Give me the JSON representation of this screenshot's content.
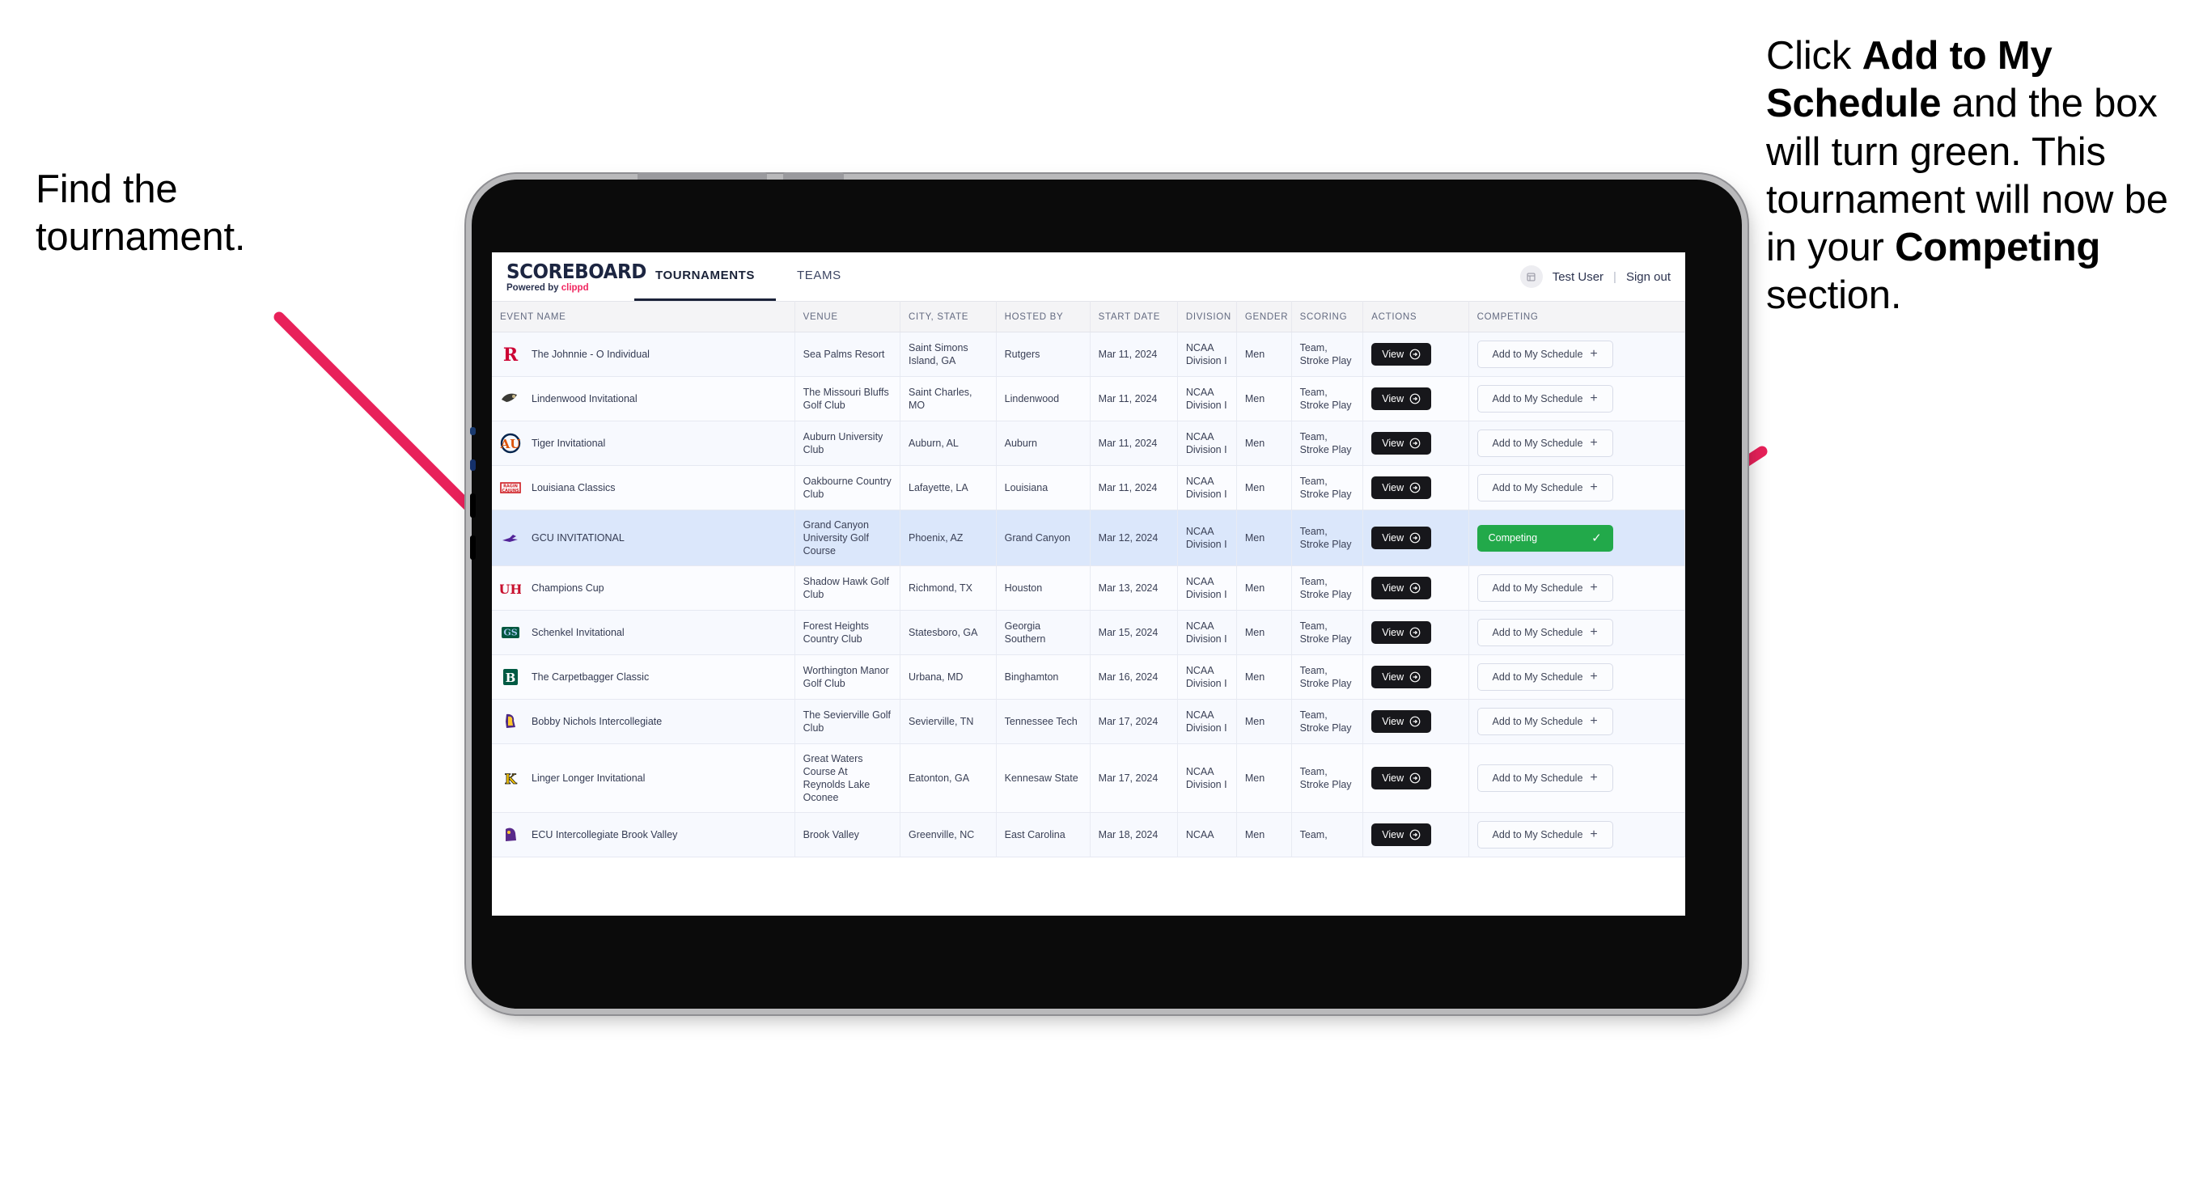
{
  "annotations": {
    "left": {
      "lines": [
        "Find the",
        "tournament."
      ]
    },
    "right": {
      "segments": [
        {
          "t": "Click ",
          "b": false
        },
        {
          "t": "Add to My Schedule",
          "b": true
        },
        {
          "t": " and the box will turn green. This tournament will now be in your ",
          "b": false
        },
        {
          "t": "Competing",
          "b": true
        },
        {
          "t": " section.",
          "b": false
        }
      ]
    },
    "arrow_color": "#E8215A"
  },
  "app": {
    "brand": {
      "title": "SCOREBOARD",
      "sub_prefix": "Powered by ",
      "sub_brand": "clippd"
    },
    "nav": [
      {
        "label": "TOURNAMENTS",
        "active": true
      },
      {
        "label": "TEAMS",
        "active": false
      }
    ],
    "header_right": {
      "avatar_icon": "user-avatar-icon",
      "user": "Test User",
      "separator": "|",
      "signout": "Sign out"
    },
    "table": {
      "columns": [
        "EVENT NAME",
        "VENUE",
        "CITY, STATE",
        "HOSTED BY",
        "START DATE",
        "DIVISION",
        "GENDER",
        "SCORING",
        "ACTIONS",
        "COMPETING"
      ],
      "view_label": "View",
      "add_label": "Add to My Schedule",
      "competing_label": "Competing",
      "rows": [
        {
          "logo": "rutgers-logo",
          "event": "The Johnnie - O Individual",
          "venue": "Sea Palms Resort",
          "city": "Saint Simons Island, GA",
          "hosted_by": "Rutgers",
          "start_date": "Mar 11, 2024",
          "division": "NCAA Division I",
          "gender": "Men",
          "scoring": "Team, Stroke Play",
          "competing": false
        },
        {
          "logo": "lindenwood-logo",
          "event": "Lindenwood Invitational",
          "venue": "The Missouri Bluffs Golf Club",
          "city": "Saint Charles, MO",
          "hosted_by": "Lindenwood",
          "start_date": "Mar 11, 2024",
          "division": "NCAA Division I",
          "gender": "Men",
          "scoring": "Team, Stroke Play",
          "competing": false
        },
        {
          "logo": "auburn-logo",
          "event": "Tiger Invitational",
          "venue": "Auburn University Club",
          "city": "Auburn, AL",
          "hosted_by": "Auburn",
          "start_date": "Mar 11, 2024",
          "division": "NCAA Division I",
          "gender": "Men",
          "scoring": "Team, Stroke Play",
          "competing": false
        },
        {
          "logo": "louisiana-logo",
          "event": "Louisiana Classics",
          "venue": "Oakbourne Country Club",
          "city": "Lafayette, LA",
          "hosted_by": "Louisiana",
          "start_date": "Mar 11, 2024",
          "division": "NCAA Division I",
          "gender": "Men",
          "scoring": "Team, Stroke Play",
          "competing": false
        },
        {
          "logo": "gcu-logo",
          "event": "GCU INVITATIONAL",
          "venue": "Grand Canyon University Golf Course",
          "city": "Phoenix, AZ",
          "hosted_by": "Grand Canyon",
          "start_date": "Mar 12, 2024",
          "division": "NCAA Division I",
          "gender": "Men",
          "scoring": "Team, Stroke Play",
          "competing": true,
          "selected": true
        },
        {
          "logo": "houston-logo",
          "event": "Champions Cup",
          "venue": "Shadow Hawk Golf Club",
          "city": "Richmond, TX",
          "hosted_by": "Houston",
          "start_date": "Mar 13, 2024",
          "division": "NCAA Division I",
          "gender": "Men",
          "scoring": "Team, Stroke Play",
          "competing": false
        },
        {
          "logo": "georgia-southern-logo",
          "event": "Schenkel Invitational",
          "venue": "Forest Heights Country Club",
          "city": "Statesboro, GA",
          "hosted_by": "Georgia Southern",
          "start_date": "Mar 15, 2024",
          "division": "NCAA Division I",
          "gender": "Men",
          "scoring": "Team, Stroke Play",
          "competing": false
        },
        {
          "logo": "binghamton-logo",
          "event": "The Carpetbagger Classic",
          "venue": "Worthington Manor Golf Club",
          "city": "Urbana, MD",
          "hosted_by": "Binghamton",
          "start_date": "Mar 16, 2024",
          "division": "NCAA Division I",
          "gender": "Men",
          "scoring": "Team, Stroke Play",
          "competing": false
        },
        {
          "logo": "tennessee-tech-logo",
          "event": "Bobby Nichols Intercollegiate",
          "venue": "The Sevierville Golf Club",
          "city": "Sevierville, TN",
          "hosted_by": "Tennessee Tech",
          "start_date": "Mar 17, 2024",
          "division": "NCAA Division I",
          "gender": "Men",
          "scoring": "Team, Stroke Play",
          "competing": false
        },
        {
          "logo": "kennesaw-logo",
          "event": "Linger Longer Invitational",
          "venue": "Great Waters Course At Reynolds Lake Oconee",
          "city": "Eatonton, GA",
          "hosted_by": "Kennesaw State",
          "start_date": "Mar 17, 2024",
          "division": "NCAA Division I",
          "gender": "Men",
          "scoring": "Team, Stroke Play",
          "competing": false
        },
        {
          "logo": "ecu-logo",
          "event": "ECU Intercollegiate Brook Valley",
          "venue": "Brook Valley",
          "city": "Greenville, NC",
          "hosted_by": "East Carolina",
          "start_date": "Mar 18, 2024",
          "division": "NCAA",
          "gender": "Men",
          "scoring": "Team,",
          "competing": false,
          "clipped": true
        }
      ]
    }
  }
}
